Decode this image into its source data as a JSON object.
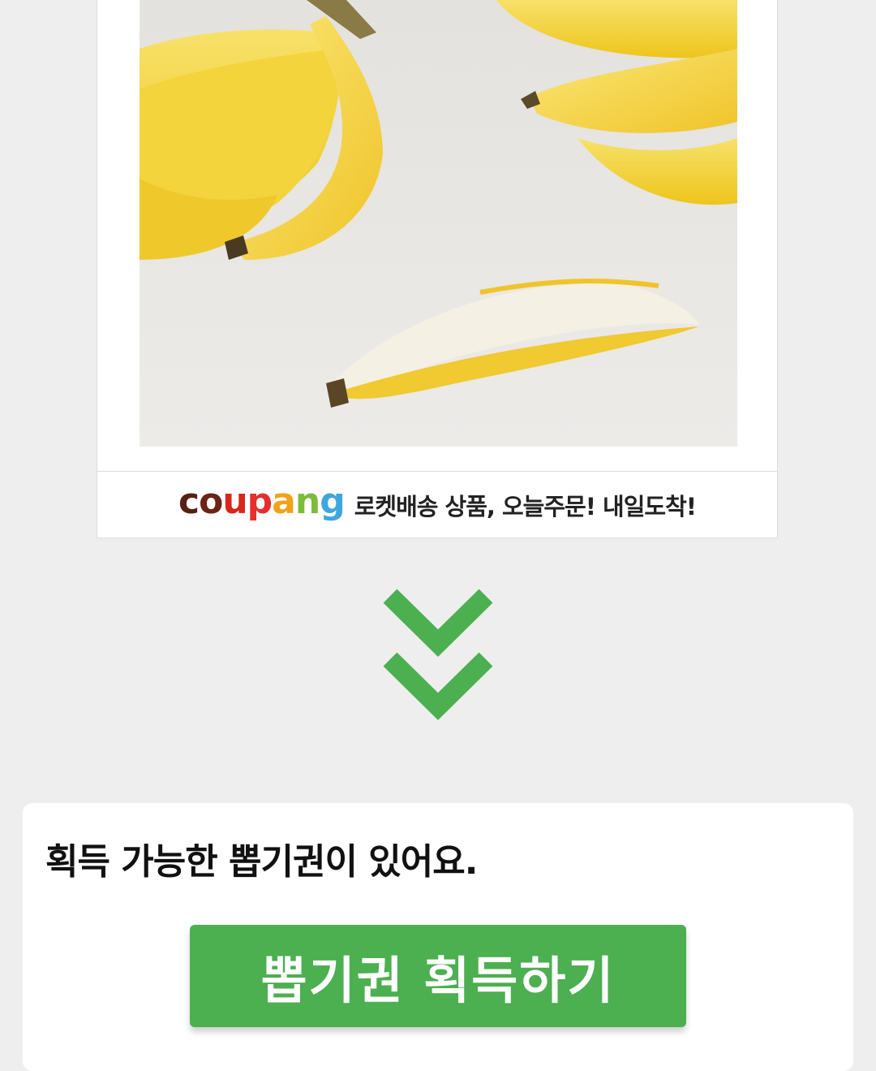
{
  "product": {
    "image_alt": "bananas",
    "promo_brand": "coupang",
    "promo_text": "로켓배송 상품, 오늘주문! 내일도착!"
  },
  "colors": {
    "accent_green": "#4caf50",
    "logo_c": "#5a1f13",
    "logo_o": "#6b2415",
    "logo_u": "#d9261c",
    "logo_p": "#e52e2e",
    "logo_a": "#f0a31a",
    "logo_n": "#7dbb3c",
    "logo_g": "#3fa7e0"
  },
  "icons": {
    "arrow": "double-chevron-down-icon"
  },
  "ticket": {
    "message": "획득 가능한 뽑기권이 있어요.",
    "button_label": "뽑기권 획득하기"
  }
}
